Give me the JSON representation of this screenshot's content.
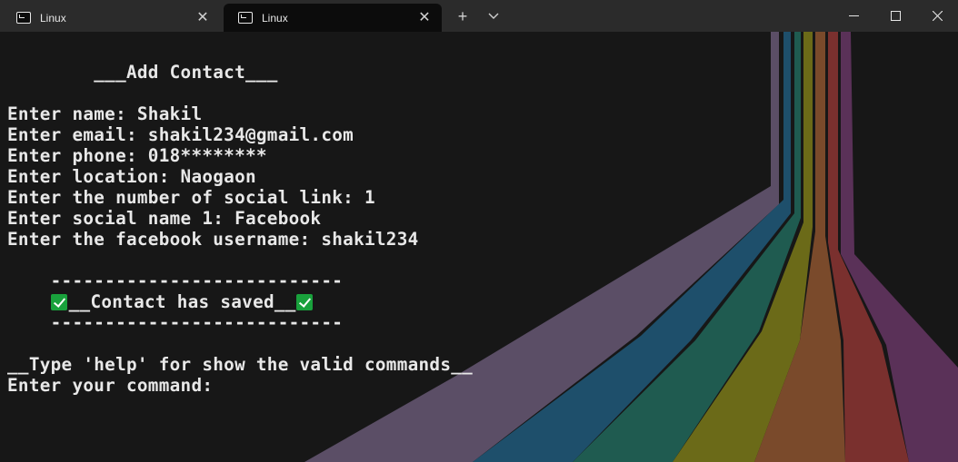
{
  "tabs": [
    {
      "title": "Linux",
      "active": false
    },
    {
      "title": "Linux",
      "active": true
    }
  ],
  "toolbar": {
    "new_tab_icon": "plus-icon",
    "dropdown_icon": "chevron-down-icon"
  },
  "window_controls": {
    "minimize": "minimize-icon",
    "maximize": "maximize-icon",
    "close": "close-icon"
  },
  "terminal": {
    "heading": "        ___Add Contact___",
    "prompts": [
      "Enter name: Shakil",
      "Enter email: shakil234@gmail.com",
      "Enter phone: 018********",
      "Enter location: Naogaon",
      "Enter the number of social link: 1",
      "Enter social name 1: Facebook",
      "Enter the facebook username: shakil234"
    ],
    "separator_top": "    ---------------------------",
    "saved_message": "__Contact has saved__",
    "separator_bottom": "    ---------------------------",
    "help_hint": "__Type 'help' for show the valid commands__",
    "command_prompt": "Enter your command:"
  },
  "colors": {
    "stripes": [
      "#5b4e66",
      "#1e4f6b",
      "#1f5b50",
      "#6b6a18",
      "#7a4a2b",
      "#7a302e",
      "#5a3158"
    ]
  }
}
